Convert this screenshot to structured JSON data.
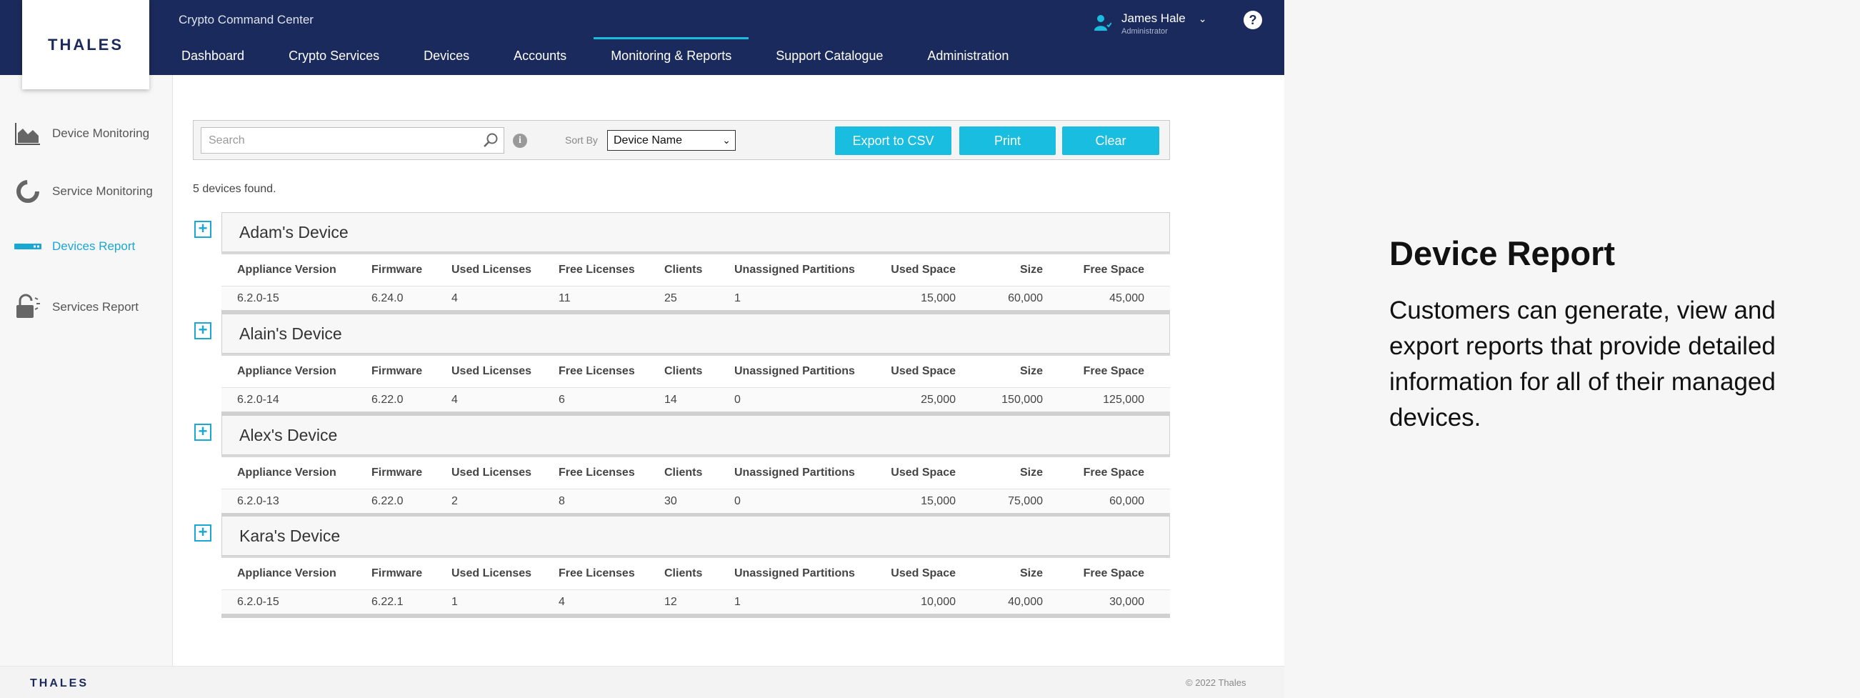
{
  "app": {
    "logo": "THALES",
    "title": "Crypto Command Center"
  },
  "nav": {
    "items": [
      "Dashboard",
      "Crypto Services",
      "Devices",
      "Accounts",
      "Monitoring & Reports",
      "Support Catalogue",
      "Administration"
    ],
    "active": "Monitoring & Reports"
  },
  "user": {
    "name": "James Hale",
    "role": "Administrator"
  },
  "sidebar": {
    "items": [
      {
        "label": "Device Monitoring",
        "icon": "area-chart-icon"
      },
      {
        "label": "Service Monitoring",
        "icon": "donut-chart-icon"
      },
      {
        "label": "Devices Report",
        "icon": "device-icon",
        "active": true
      },
      {
        "label": "Services Report",
        "icon": "lock-icon"
      }
    ]
  },
  "toolbar": {
    "search_placeholder": "Search",
    "sort_by_label": "Sort By",
    "sort_value": "Device Name",
    "export_label": "Export to CSV",
    "print_label": "Print",
    "clear_label": "Clear"
  },
  "result_count": "5 devices found.",
  "columns": [
    "Appliance Version",
    "Firmware",
    "Used Licenses",
    "Free Licenses",
    "Clients",
    "Unassigned Partitions",
    "Used Space",
    "Size",
    "Free Space"
  ],
  "devices": [
    {
      "name": "Adam's Device",
      "row": [
        "6.2.0-15",
        "6.24.0",
        "4",
        "11",
        "25",
        "1",
        "15,000",
        "60,000",
        "45,000"
      ]
    },
    {
      "name": "Alain's Device",
      "row": [
        "6.2.0-14",
        "6.22.0",
        "4",
        "6",
        "14",
        "0",
        "25,000",
        "150,000",
        "125,000"
      ]
    },
    {
      "name": "Alex's Device",
      "row": [
        "6.2.0-13",
        "6.22.0",
        "2",
        "8",
        "30",
        "0",
        "15,000",
        "75,000",
        "60,000"
      ]
    },
    {
      "name": "Kara's Device",
      "row": [
        "6.2.0-15",
        "6.22.1",
        "1",
        "4",
        "12",
        "1",
        "10,000",
        "40,000",
        "30,000"
      ]
    }
  ],
  "footer": {
    "logo": "THALES",
    "copyright": "© 2022 Thales"
  },
  "description": {
    "title": "Device Report",
    "body": "Customers can generate, view and export reports that provide detailed information for all of their managed devices."
  },
  "colors": {
    "navy": "#1b2a5c",
    "accent": "#19bde0"
  }
}
